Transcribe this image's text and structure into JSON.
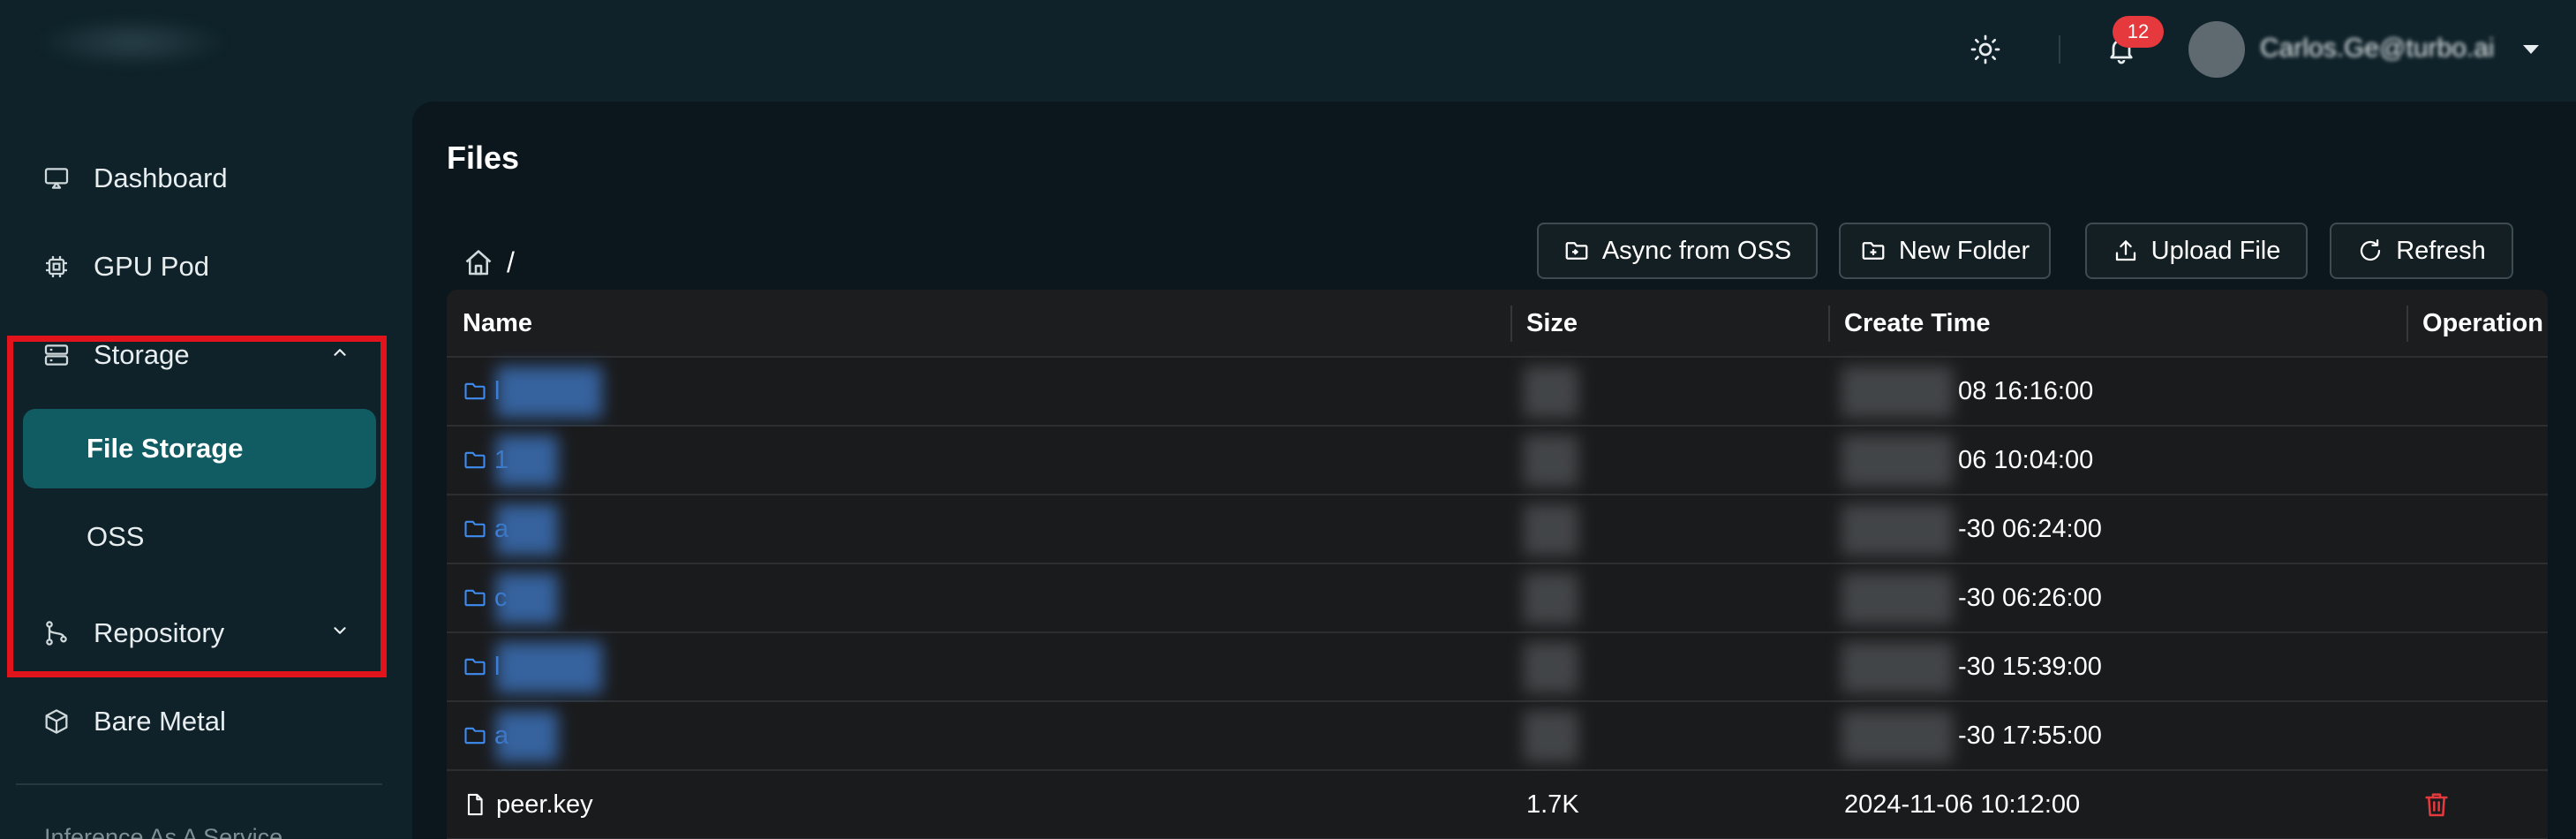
{
  "header": {
    "notification_count": "12",
    "user_email": "Carlos.Ge@turbo.ai"
  },
  "sidebar": {
    "items": [
      {
        "label": "Dashboard",
        "icon": "monitor-icon"
      },
      {
        "label": "GPU Pod",
        "icon": "chip-icon"
      },
      {
        "label": "Storage",
        "icon": "storage-icon",
        "expanded": true,
        "children": [
          {
            "label": "File Storage",
            "active": true
          },
          {
            "label": "OSS"
          }
        ]
      },
      {
        "label": "Repository",
        "icon": "git-branch-icon",
        "expanded": false
      },
      {
        "label": "Bare Metal",
        "icon": "cube-icon"
      }
    ],
    "footer": "Inference As A Service"
  },
  "main": {
    "title": "Files",
    "breadcrumb_sep": "/",
    "buttons": {
      "async": "Async from OSS",
      "new_folder": "New Folder",
      "upload": "Upload File",
      "refresh": "Refresh"
    },
    "table": {
      "columns": [
        "Name",
        "Size",
        "Create Time",
        "Operation"
      ],
      "rows": [
        {
          "type": "folder",
          "name": "l",
          "size": "",
          "ctime": "08 16:16:00"
        },
        {
          "type": "folder",
          "name": "1",
          "size": "",
          "ctime": "06 10:04:00"
        },
        {
          "type": "folder",
          "name": "a",
          "size": "",
          "ctime": "-30 06:24:00"
        },
        {
          "type": "folder",
          "name": "c",
          "size": "",
          "ctime": "-30 06:26:00"
        },
        {
          "type": "folder",
          "name": "l",
          "size": "",
          "ctime": "-30 15:39:00"
        },
        {
          "type": "folder",
          "name": "a",
          "size": "",
          "ctime": "-30 17:55:00"
        },
        {
          "type": "file",
          "name": "peer.key",
          "size": "1.7K",
          "ctime": "2024-11-06 10:12:00",
          "deletable": true
        }
      ]
    }
  },
  "colors": {
    "background": "#0f2229",
    "panel": "#0b171c",
    "active_nav": "#115c63",
    "folder_link": "#3f8cf0",
    "badge": "#e5393d",
    "delete": "#e5393d",
    "highlight_box": "#e0141a"
  }
}
